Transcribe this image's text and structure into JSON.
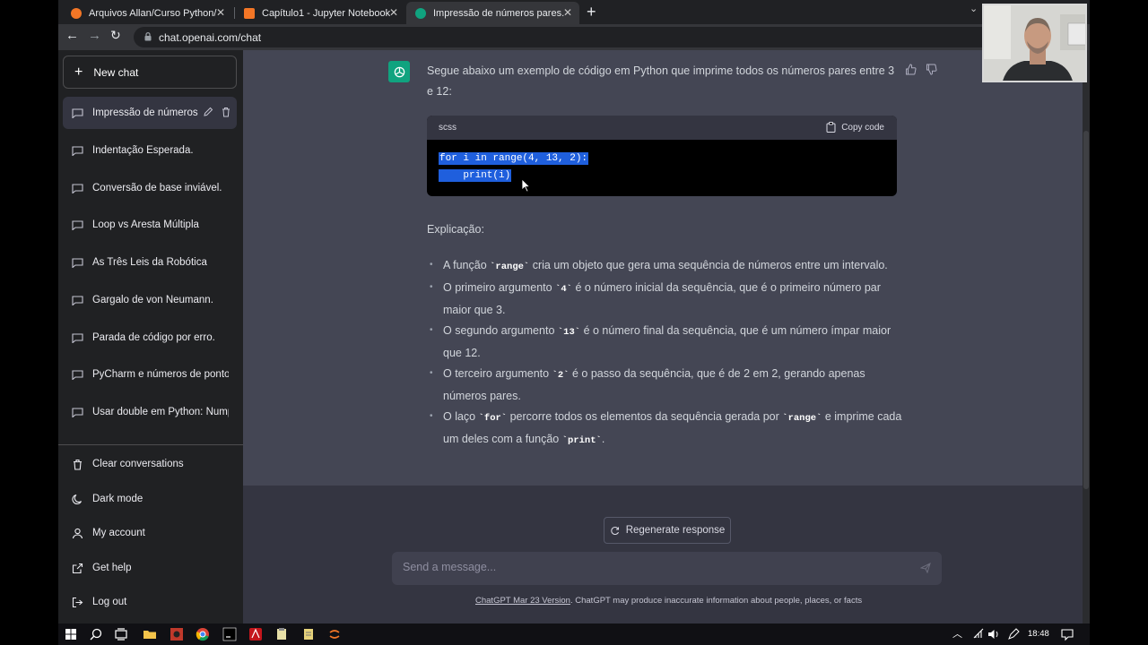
{
  "browser": {
    "tabs": [
      {
        "title": "Arquivos Allan/Curso Python/",
        "icon": "folder-icon"
      },
      {
        "title": "Capítulo1 - Jupyter Notebook",
        "icon": "jupyter-icon"
      },
      {
        "title": "Impressão de números pares.",
        "icon": "chatgpt-icon",
        "active": true
      }
    ],
    "new_tab_label": "+",
    "url": "chat.openai.com/chat"
  },
  "sidebar": {
    "new_chat_label": "New chat",
    "conversations": [
      {
        "label": "Impressão de números",
        "active": true
      },
      {
        "label": "Indentação Esperada."
      },
      {
        "label": "Conversão de base inviável."
      },
      {
        "label": "Loop vs Aresta Múltipla"
      },
      {
        "label": "As Três Leis da Robótica"
      },
      {
        "label": "Gargalo de von Neumann."
      },
      {
        "label": "Parada de código por erro."
      },
      {
        "label": "PyCharm e números de ponto"
      },
      {
        "label": "Usar double em Python: Nump"
      }
    ],
    "menu": [
      {
        "label": "Clear conversations",
        "icon": "trash-icon"
      },
      {
        "label": "Dark mode",
        "icon": "moon-icon"
      },
      {
        "label": "My account",
        "icon": "user-icon"
      },
      {
        "label": "Get help",
        "icon": "external-link-icon"
      },
      {
        "label": "Log out",
        "icon": "logout-icon"
      }
    ]
  },
  "answer": {
    "intro": "Segue abaixo um exemplo de código em Python que imprime todos os números pares entre 3 e 12:",
    "code": {
      "language": "scss",
      "copy_label": "Copy code",
      "lines": [
        "for i in range(4, 13, 2):",
        "    print(i)"
      ]
    },
    "explanation_title": "Explicação:",
    "bullets": [
      {
        "pre": "A função ",
        "code": "`range`",
        "post": " cria um objeto que gera uma sequência de números entre um intervalo."
      },
      {
        "pre": "O primeiro argumento ",
        "code": "`4`",
        "post": " é o número inicial da sequência, que é o primeiro número par maior que 3."
      },
      {
        "pre": "O segundo argumento ",
        "code": "`13`",
        "post": " é o número final da sequência, que é um número ímpar maior que 12."
      },
      {
        "pre": "O terceiro argumento ",
        "code": "`2`",
        "post": " é o passo da sequência, que é de 2 em 2, gerando apenas números pares."
      },
      {
        "pre": "O laço ",
        "code": "`for`",
        "mid": " percorre todos os elementos da sequência gerada por ",
        "code2": "`range`",
        "post": " e imprime cada um deles com a função ",
        "code3": "`print`",
        "post2": "."
      }
    ]
  },
  "composer": {
    "regenerate_label": "Regenerate response",
    "placeholder": "Send a message...",
    "footer_link": "ChatGPT Mar 23 Version",
    "footer_text": ". ChatGPT may produce inaccurate information about people, places, or facts"
  },
  "taskbar": {
    "time": "18:48"
  },
  "colors": {
    "sidebar_bg": "#202123",
    "main_bg": "#343541",
    "answer_bg": "#444654",
    "accent": "#10a37f",
    "selection": "#1f5fdd"
  }
}
